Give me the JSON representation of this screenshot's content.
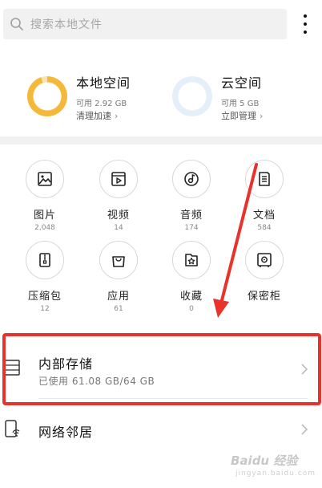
{
  "search": {
    "placeholder": "搜索本地文件"
  },
  "storage": {
    "local": {
      "title": "本地空间",
      "available": "可用 2.92 GB",
      "action": "清理加速",
      "used_fraction": 0.95,
      "color": "#f5b93a"
    },
    "cloud": {
      "title": "云空间",
      "available": "可用 5 GB",
      "action": "立即管理",
      "used_fraction": 0.0,
      "color": "#e4effa"
    }
  },
  "categories": [
    {
      "label": "图片",
      "count": "2,048",
      "icon": "image-icon"
    },
    {
      "label": "视频",
      "count": "14",
      "icon": "video-icon"
    },
    {
      "label": "音频",
      "count": "174",
      "icon": "audio-icon"
    },
    {
      "label": "文档",
      "count": "584",
      "icon": "document-icon"
    },
    {
      "label": "压缩包",
      "count": "12",
      "icon": "archive-icon"
    },
    {
      "label": "应用",
      "count": "61",
      "icon": "app-bag-icon"
    },
    {
      "label": "收藏",
      "count": "0",
      "icon": "favorites-icon"
    },
    {
      "label": "保密柜",
      "count": "",
      "icon": "safe-icon"
    }
  ],
  "internal_storage": {
    "title": "内部存储",
    "usage": "已使用 61.08 GB/64 GB"
  },
  "network": {
    "title": "网络邻居"
  },
  "watermark": {
    "brand": "Baidu 经验",
    "sub": "jingyan.baidu.com"
  },
  "colors": {
    "annotation": "#e8322b",
    "accent_local": "#f5b93a",
    "accent_cloud": "#e4effa"
  }
}
